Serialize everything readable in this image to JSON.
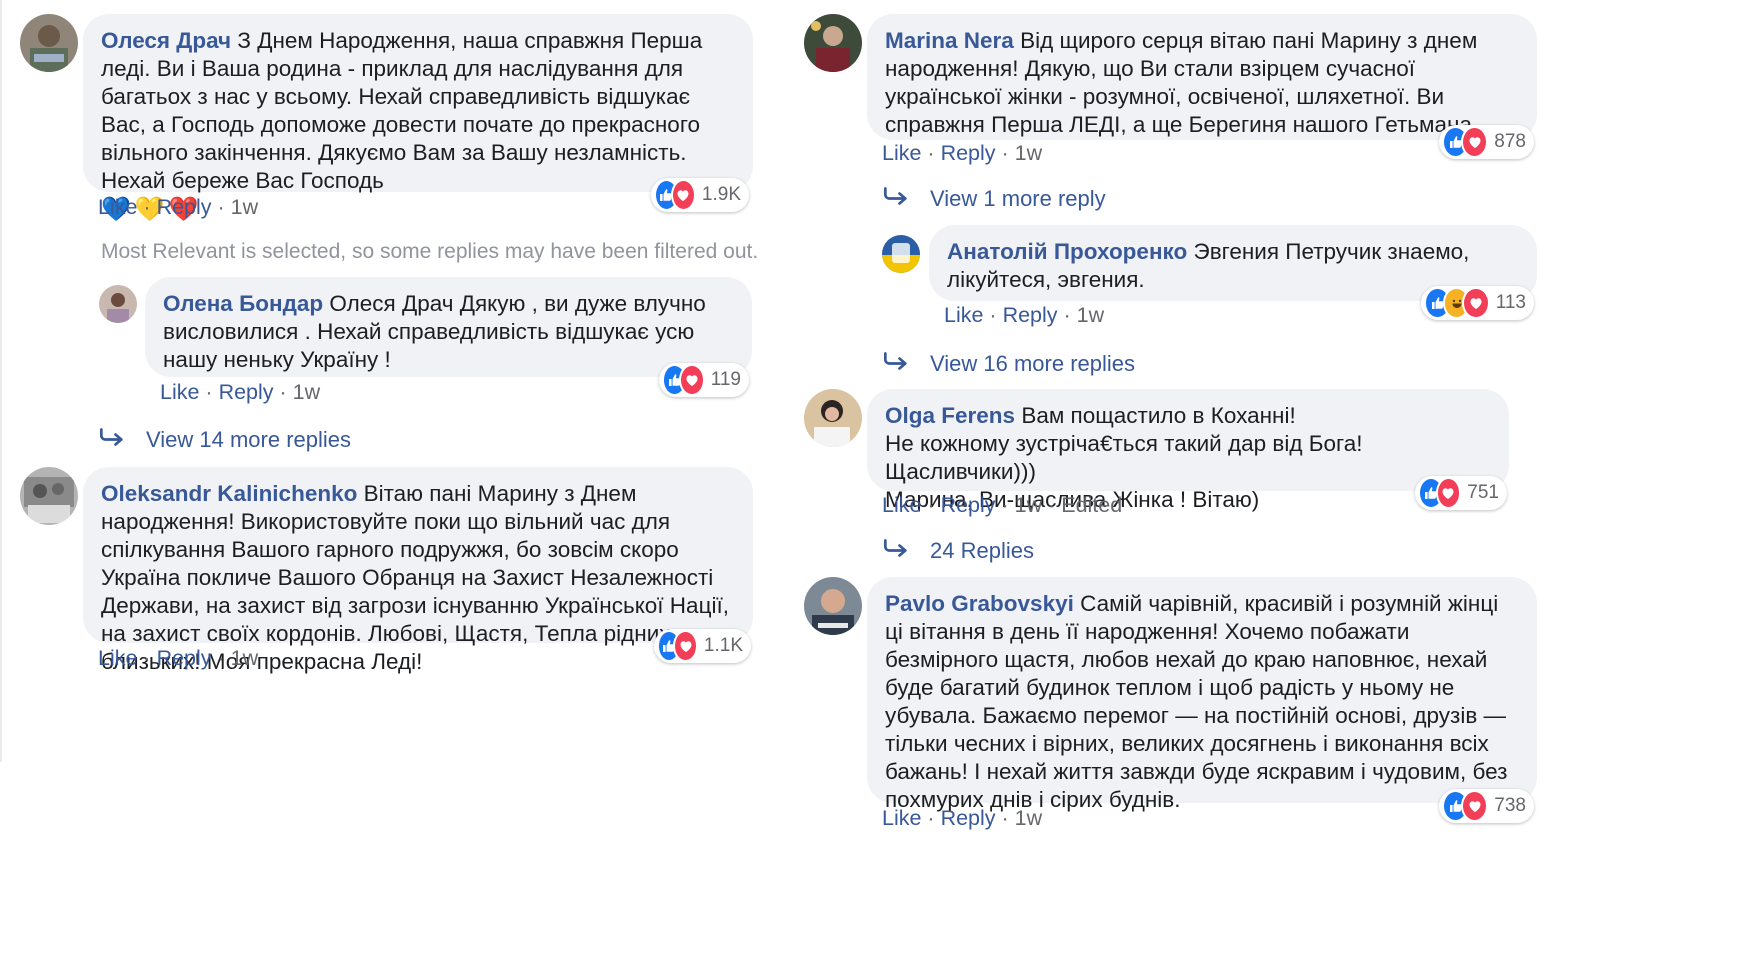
{
  "left": {
    "filtered_note": "Most Relevant is selected, so some replies may have been filtered out.",
    "comments": [
      {
        "author": "Олеся Драч",
        "text": "З Днем Народження, наша справжня Перша леді. Ви і Ваша родина - приклад для наслідування для багатьох з нас у всьому. Нехай справедливість відшукає Вас, а Господь допоможе довести почате до прекрасного вільного закінчення. Дякуємо Вам за Вашу незламність. Нехай береже Вас Господь",
        "emojis": [
          "💙",
          "💛",
          "❤️"
        ],
        "like": "Like",
        "reply": "Reply",
        "time": "1w",
        "reactions_count": "1.9K"
      },
      {
        "author": "Олена Бондар",
        "text": "Олеся Драч Дякую , ви дуже влучно висловилися . Нехай справедливість відшукає усю нашу неньку Україну !",
        "like": "Like",
        "reply": "Reply",
        "time": "1w",
        "reactions_count": "119"
      },
      {
        "author": "Oleksandr Kalinichenko",
        "text": "Вітаю пані Марину з Днем народження! Використовуйте поки що вільний час для спілкування Вашого гарного подружжя, бо зовсім скоро Україна покличе Вашого Обранця на Захист Незалежності Держави, на захист від загрози існуванню Української Нації, на захист своїх кордонів. Любові, Щастя, Тепла рідних та близьких! Моя прекрасна Леді!",
        "like": "Like",
        "reply": "Reply",
        "time": "1w",
        "reactions_count": "1.1K"
      }
    ],
    "view_more_1": "View 14 more replies"
  },
  "right": {
    "comments": [
      {
        "author": "Marina Nera",
        "text": "Від щирого серця вітаю пані Марину з днем народження! Дякую, що Ви стали взірцем сучасної української жінки - розумної, освіченої, шляхетної. Ви справжня Перша ЛЕДІ, а ще Берегиня нашого Гетьмана",
        "like": "Like",
        "reply": "Reply",
        "time": "1w",
        "reactions_count": "878"
      },
      {
        "author": "Анатолій Прохоренко",
        "text": "Эвгения Петручик знаемо, лікуйтеся, эвгения.",
        "like": "Like",
        "reply": "Reply",
        "time": "1w",
        "reactions_count": "113"
      },
      {
        "author": "Olga Ferens",
        "text": "Вам пощастило в Коханні!\nНе кожному зустріча€ться такий дар від Бога! Щасливчики)))\nМарина, Ви-щаслива Жінка ! Вітаю)",
        "like": "Like",
        "reply": "Reply",
        "time": "1w",
        "edited": "Edited",
        "reactions_count": "751"
      },
      {
        "author": "Pavlo Grabovskyi",
        "text": "Самій чарівній, красивій і розумній жінці ці вітання в день її народження! Хочемо побажати безмірного щастя, любов нехай до краю наповнює, нехай буде багатий будинок теплом і щоб радість у ньому не убувала. Бажаємо перемог — на постійній основі, друзів — тільки чесних і вірних, великих досягнень і виконання всіх бажань! І нехай життя завжди буде яскравим і чудовим, без похмурих днів і сірих буднів.",
        "like": "Like",
        "reply": "Reply",
        "time": "1w",
        "reactions_count": "738"
      }
    ],
    "view_more_1": "View 1 more reply",
    "view_more_2": "View 16 more replies",
    "view_more_3": "24 Replies"
  },
  "colors": {
    "author": "#385898",
    "bubble": "#f0f2f5",
    "like": "#1877f2",
    "love": "#f33e58",
    "haha": "#f7b125"
  },
  "icons": [
    "reply-arrow-icon",
    "like-reaction-icon",
    "love-reaction-icon",
    "haha-reaction-icon"
  ]
}
